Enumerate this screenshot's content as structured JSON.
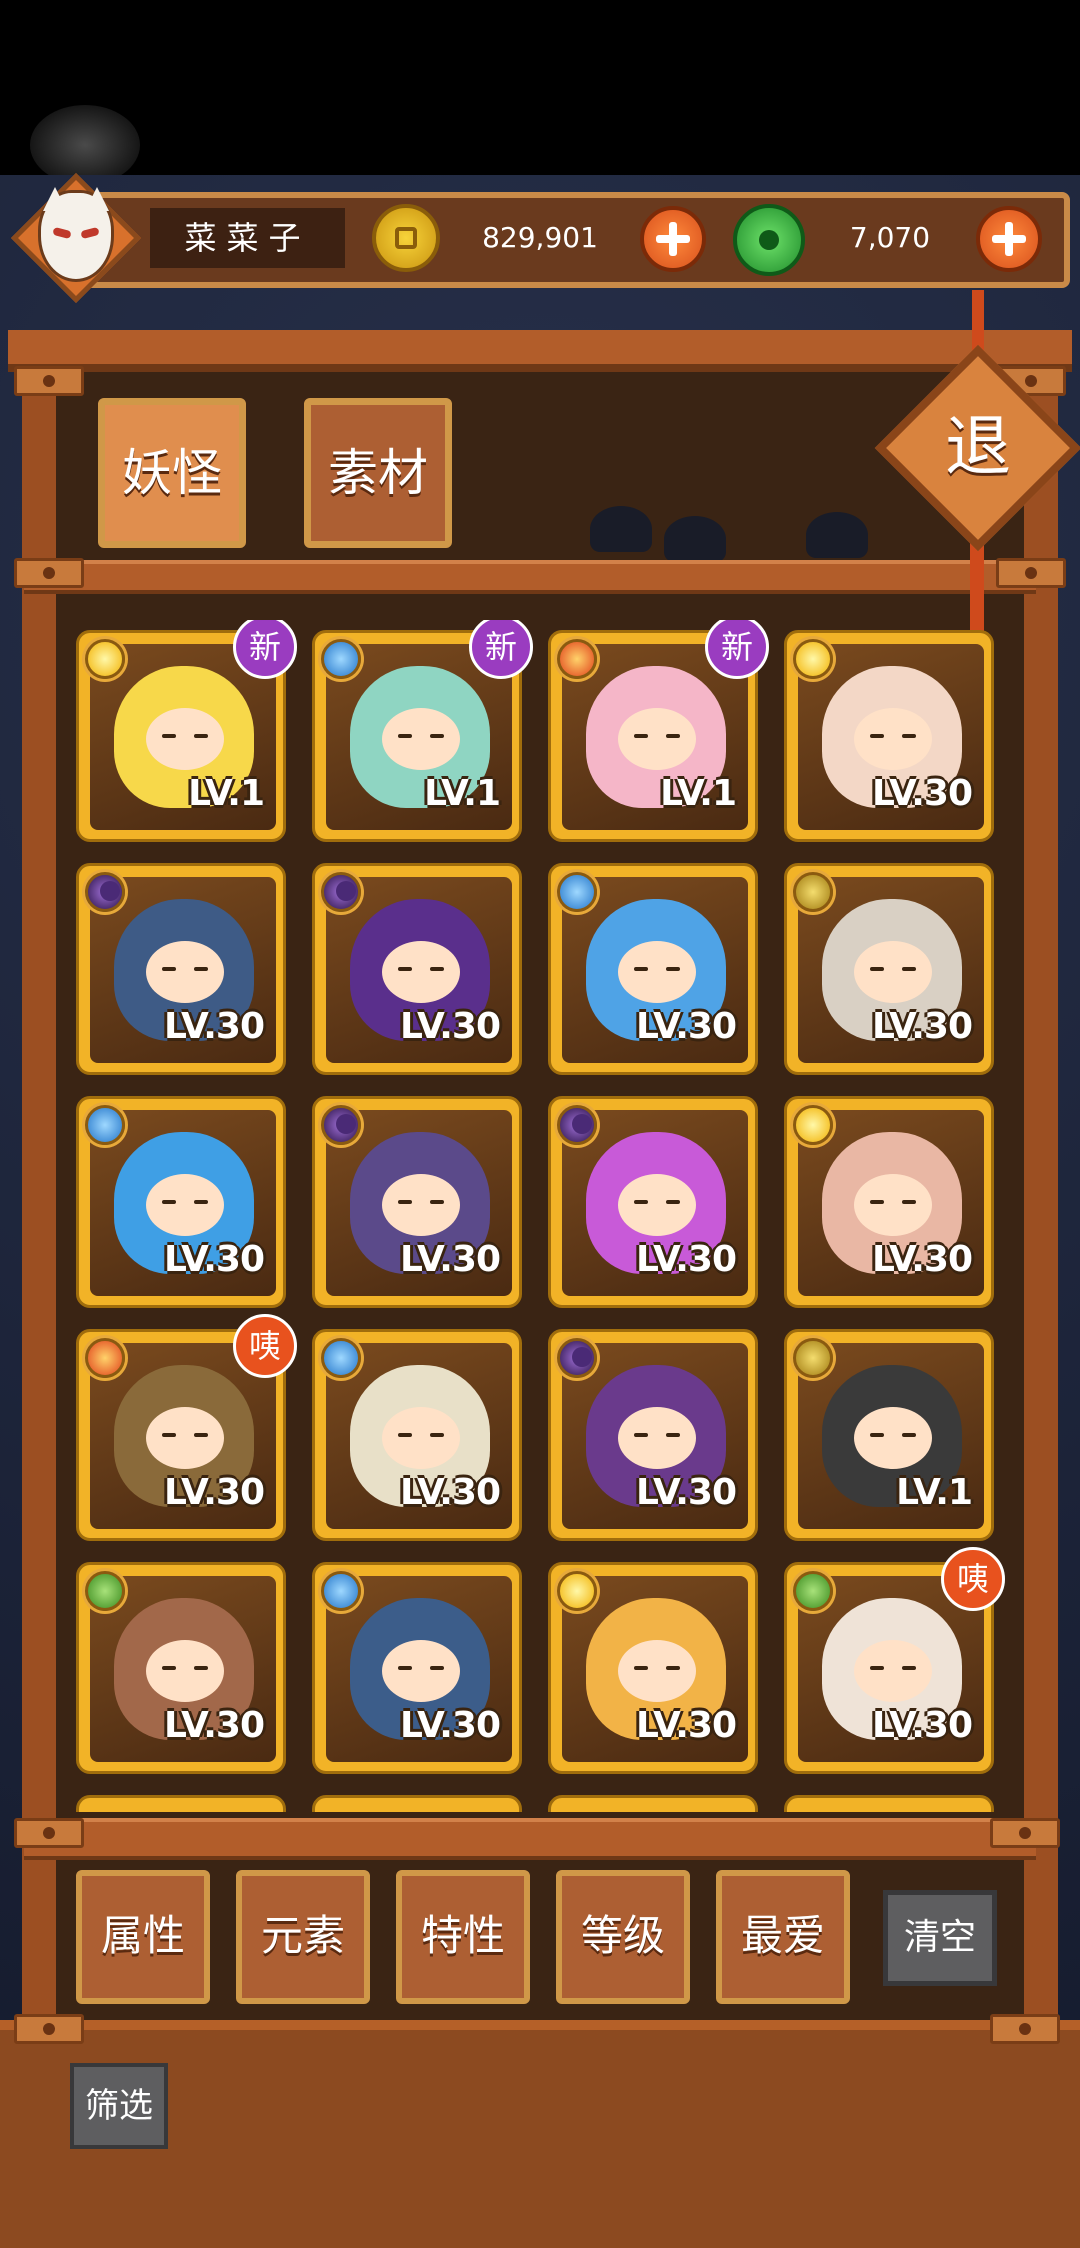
{
  "player": {
    "name": "菜菜子",
    "avatar_icon": "fox-mask-icon"
  },
  "currency": {
    "coins": "829,901",
    "coin_icon": "gold-coin-icon",
    "gems": "7,070",
    "gem_icon": "jade-orb-icon"
  },
  "tabs": [
    {
      "label": "妖怪",
      "active": true
    },
    {
      "label": "素材",
      "active": false
    }
  ],
  "exit_label": "退",
  "monsters": [
    {
      "element": "light",
      "level": "LV.1",
      "badge": "新",
      "color": "#f7d84a"
    },
    {
      "element": "water",
      "level": "LV.1",
      "badge": "新",
      "color": "#8fd5c2"
    },
    {
      "element": "fire",
      "level": "LV.1",
      "badge": "新",
      "color": "#f5b6c8"
    },
    {
      "element": "light",
      "level": "LV.30",
      "badge": "",
      "color": "#f3d7c6"
    },
    {
      "element": "dark",
      "level": "LV.30",
      "badge": "",
      "color": "#3e5b86"
    },
    {
      "element": "dark",
      "level": "LV.30",
      "badge": "",
      "color": "#5a2f8c"
    },
    {
      "element": "water",
      "level": "LV.30",
      "badge": "",
      "color": "#4fa3e6"
    },
    {
      "element": "earth",
      "level": "LV.30",
      "badge": "",
      "color": "#d9d0c4"
    },
    {
      "element": "water",
      "level": "LV.30",
      "badge": "",
      "color": "#3f9fe5"
    },
    {
      "element": "dark",
      "level": "LV.30",
      "badge": "",
      "color": "#5b4a8a"
    },
    {
      "element": "dark",
      "level": "LV.30",
      "badge": "",
      "color": "#c85ad8"
    },
    {
      "element": "light",
      "level": "LV.30",
      "badge": "",
      "color": "#e9b7a4"
    },
    {
      "element": "fire",
      "level": "LV.30",
      "badge": "咦",
      "color": "#8a6a3a"
    },
    {
      "element": "water",
      "level": "LV.30",
      "badge": "",
      "color": "#e8e0c8"
    },
    {
      "element": "dark",
      "level": "LV.30",
      "badge": "",
      "color": "#6a3a8c"
    },
    {
      "element": "earth",
      "level": "LV.1",
      "badge": "",
      "color": "#3a3a3a"
    },
    {
      "element": "wood",
      "level": "LV.30",
      "badge": "",
      "color": "#a2684a"
    },
    {
      "element": "water",
      "level": "LV.30",
      "badge": "",
      "color": "#3c5d8a"
    },
    {
      "element": "light",
      "level": "LV.30",
      "badge": "",
      "color": "#f2b347"
    },
    {
      "element": "wood",
      "level": "LV.30",
      "badge": "咦",
      "color": "#efe3d7"
    }
  ],
  "filters": [
    "属性",
    "元素",
    "特性",
    "等级",
    "最爱"
  ],
  "clear_label": "清空",
  "screen_label": "筛选"
}
